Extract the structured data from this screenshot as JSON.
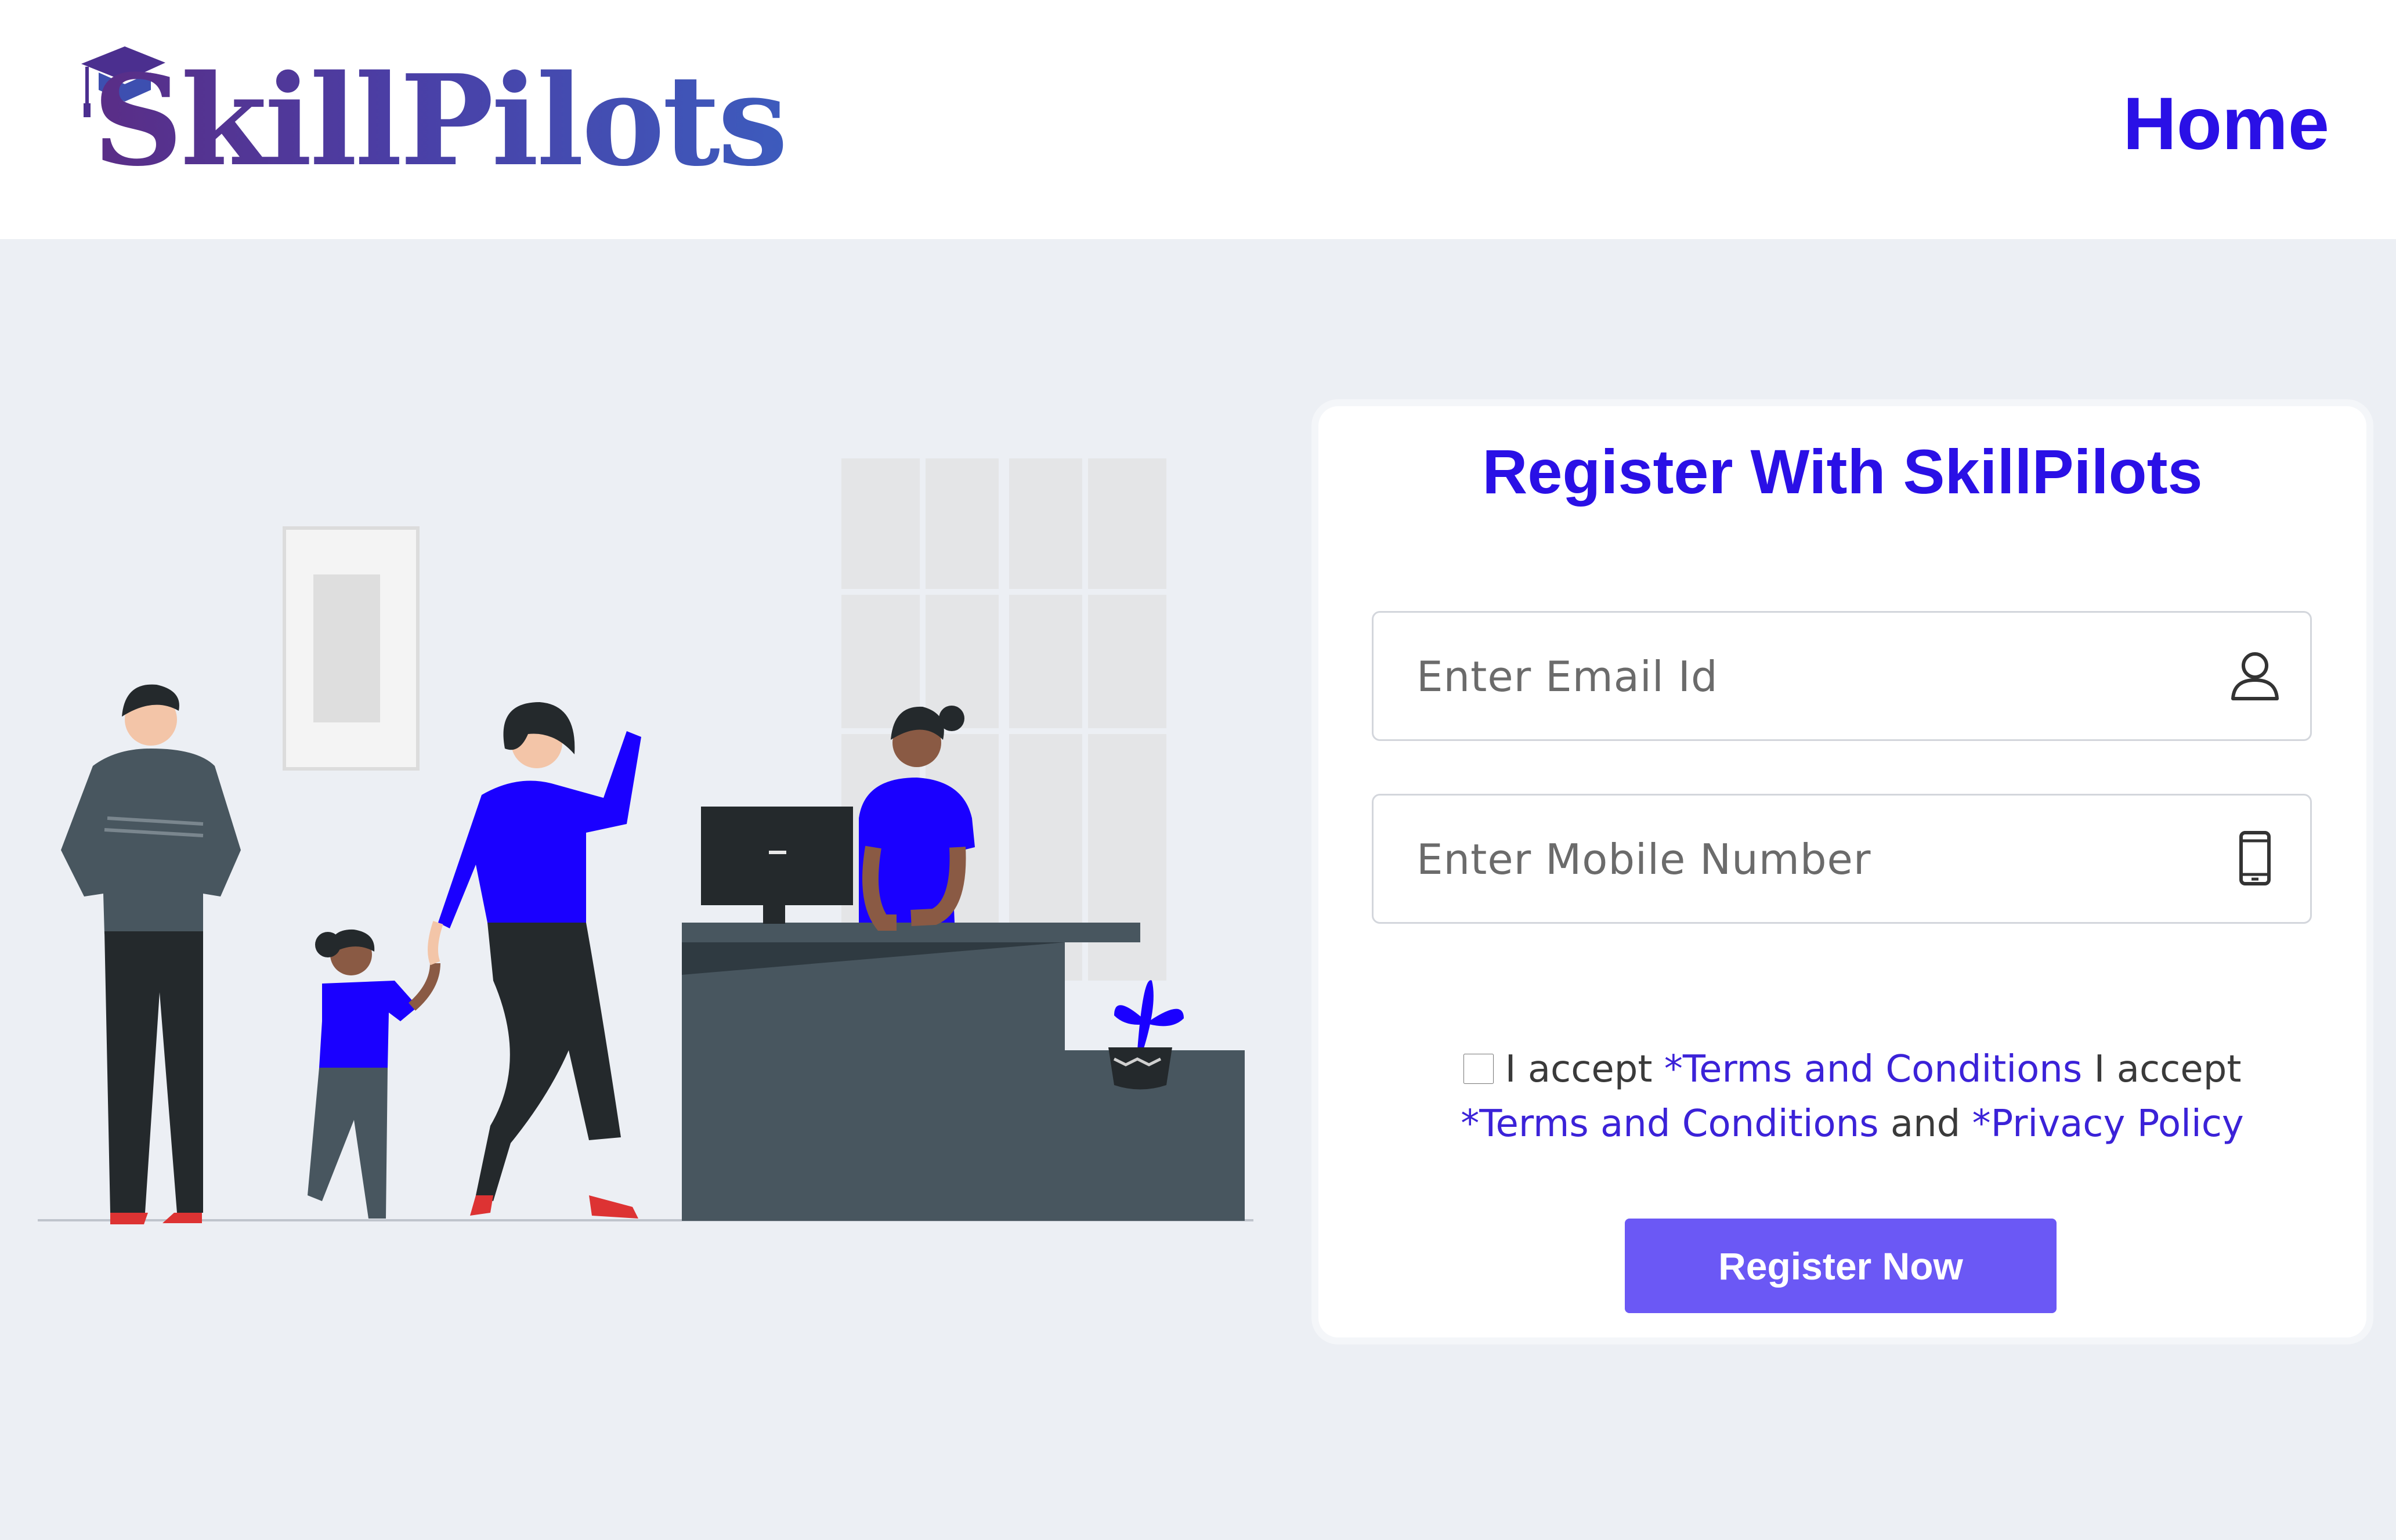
{
  "header": {
    "logo_text": "SkillPilots",
    "nav_home": "Home"
  },
  "form": {
    "title": "Register With SkillPilots",
    "email_placeholder": "Enter Email Id",
    "mobile_placeholder": "Enter Mobile Number",
    "terms": {
      "checked": false,
      "prefix_1": "I accept ",
      "link_terms_1": "*Terms and Conditions",
      "prefix_2": " I accept ",
      "link_terms_2": "*Terms and Conditions",
      "and_text": " and ",
      "link_privacy": "*Privacy Policy"
    },
    "submit_label": "Register Now"
  },
  "icons": {
    "email_field_icon": "user-icon",
    "mobile_field_icon": "phone-icon"
  },
  "colors": {
    "brand_blue": "#2a10e6",
    "button": "#6b58f5",
    "background": "#eceff4",
    "illustration_accent": "#1a00ff",
    "illustration_dark": "#48565f"
  }
}
